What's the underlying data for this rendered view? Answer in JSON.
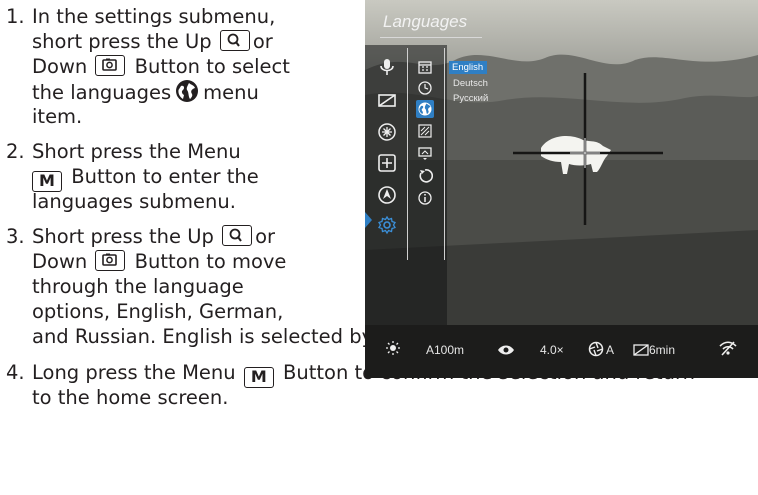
{
  "steps": {
    "s1": {
      "num": "1.",
      "l1": "In the settings submenu,",
      "l2a": "short press the Up",
      "l2b": "or",
      "l3a": "Down",
      "l3b": "Button to select",
      "l4a": "the languages",
      "l4b": "menu",
      "l5": "item."
    },
    "s2": {
      "num": "2.",
      "l1": "Short press the Menu",
      "l2": "Button to enter the",
      "l3": "languages submenu."
    },
    "s3": {
      "num": "3.",
      "l1a": "Short press the Up",
      "l1b": "or",
      "l2a": "Down",
      "l2b": "Button to move",
      "l3": "through the language",
      "l4": "options, English, German,",
      "l5": "and Russian. English is selected by default."
    },
    "s4": {
      "num": "4.",
      "l1a": "Long press the Menu",
      "l1b": "Button to confirm the selection and return",
      "l2": "to the home screen."
    }
  },
  "keys": {
    "menu": "M"
  },
  "screen": {
    "title": "Languages",
    "languages": [
      "English",
      "Deutsch",
      "Русский"
    ],
    "selected_language": "English",
    "left_icons": [
      "microphone-icon",
      "display-off-icon",
      "brightness-icon",
      "grid-plus-icon",
      "compass-icon",
      "settings-icon"
    ],
    "submenu_icons": [
      "calendar-icon",
      "clock-icon",
      "globe-icon",
      "calibration-icon",
      "screen-icon",
      "restore-icon",
      "info-icon"
    ],
    "status": {
      "range": "A100m",
      "zoom": "4.0×",
      "aperture": "A",
      "auto_off": "6min"
    },
    "colors": {
      "accent": "#2f7fc4"
    }
  }
}
